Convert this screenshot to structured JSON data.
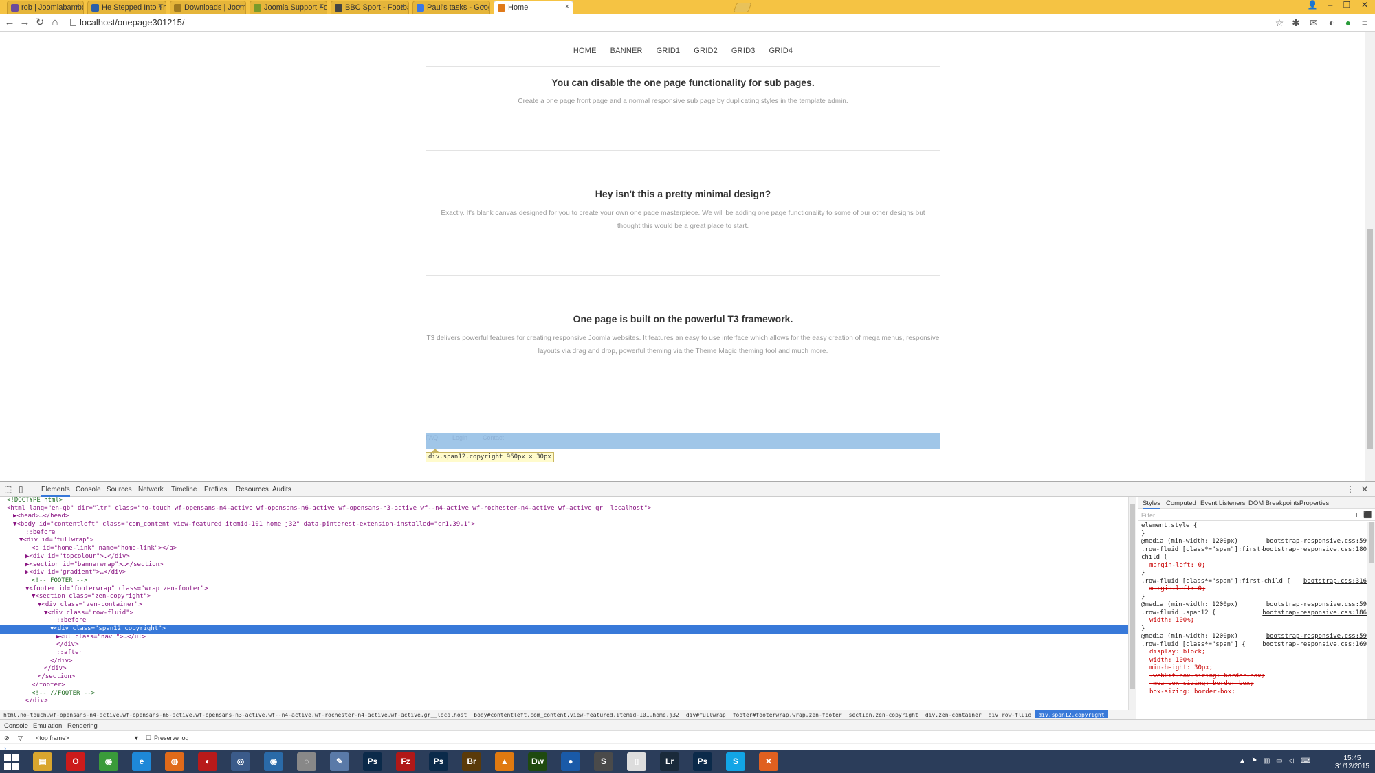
{
  "browser": {
    "tabs": [
      {
        "label": "rob | Joomlabamboo Slack",
        "color": "#6b4c9a"
      },
      {
        "label": "He Stepped Into This Pen",
        "color": "#2c5fa8"
      },
      {
        "label": "Downloads | Joomlabamboo",
        "color": "#a07a20"
      },
      {
        "label": "Joomla Support Forum :: D",
        "color": "#7a9a2a"
      },
      {
        "label": "BBC Sport - Football",
        "color": "#444444"
      },
      {
        "label": "Paul's tasks - Google Docs",
        "color": "#3b78e7"
      },
      {
        "label": "Home",
        "color": "#e07a1a"
      }
    ],
    "address": "localhost/onepage301215/"
  },
  "site": {
    "nav": [
      "HOME",
      "BANNER",
      "GRID1",
      "GRID2",
      "GRID3",
      "GRID4"
    ],
    "sections": [
      {
        "title": "You can disable the one page functionality for sub pages.",
        "text": [
          "Create a one page front page and a normal responsive sub page by duplicating styles in the template admin."
        ]
      },
      {
        "title": "Hey isn't this a pretty minimal design?",
        "text": [
          "Exactly. It's  blank canvas designed for you to create your own one page masterpiece. We will be adding one page functionality to some of our other designs but",
          "thought this would be a great place to start."
        ]
      },
      {
        "title": "One page is built on the powerful T3 framework.",
        "text": [
          "T3 delivers powerful features for creating responsive Joomla websites. It features an easy to use interface which allows for the easy creation of mega menus, responsive",
          "layouts via drag and drop, powerful theming via the Theme Magic theming tool and much more."
        ]
      }
    ],
    "footer_links": [
      "FAQ",
      "Login",
      "Contact"
    ],
    "inspect_tooltip": "div.span12.copyright 960px × 30px"
  },
  "devtools": {
    "tabs": [
      "Elements",
      "Console",
      "Sources",
      "Network",
      "Timeline",
      "Profiles",
      "Resources",
      "Audits"
    ],
    "dom_lines": [
      {
        "indent": 0,
        "text": "<!DOCTYPE html>",
        "kind": "comment"
      },
      {
        "indent": 0,
        "text": "<html lang=\"en-gb\" dir=\"ltr\" class=\"no-touch wf-opensans-n4-active wf-opensans-n6-active wf-opensans-n3-active wf--n4-active wf-rochester-n4-active wf-active gr__localhost\">",
        "kind": "tag"
      },
      {
        "indent": 1,
        "text": "▶<head>…</head>",
        "kind": "tag"
      },
      {
        "indent": 1,
        "text": "▼<body id=\"contentleft\" class=\"com_content view-featured itemid-101 home j32\" data-pinterest-extension-installed=\"cr1.39.1\">",
        "kind": "tag"
      },
      {
        "indent": 3,
        "text": "::before",
        "kind": "pseudo"
      },
      {
        "indent": 2,
        "text": "▼<div id=\"fullwrap\">",
        "kind": "tag"
      },
      {
        "indent": 4,
        "text": "<a id=\"home-link\" name=\"home-link\"></a>",
        "kind": "tag"
      },
      {
        "indent": 3,
        "text": "▶<div id=\"topcolour\">…</div>",
        "kind": "tag"
      },
      {
        "indent": 3,
        "text": "▶<section id=\"bannerwrap\">…</section>",
        "kind": "tag"
      },
      {
        "indent": 3,
        "text": "▶<div id=\"gradient\">…</div>",
        "kind": "tag"
      },
      {
        "indent": 4,
        "text": "<!-- FOOTER -->",
        "kind": "comment"
      },
      {
        "indent": 3,
        "text": "▼<footer id=\"footerwrap\" class=\"wrap zen-footer\">",
        "kind": "tag"
      },
      {
        "indent": 4,
        "text": "▼<section class=\"zen-copyright\">",
        "kind": "tag"
      },
      {
        "indent": 5,
        "text": "▼<div class=\"zen-container\">",
        "kind": "tag"
      },
      {
        "indent": 6,
        "text": "▼<div class=\"row-fluid\">",
        "kind": "tag"
      },
      {
        "indent": 8,
        "text": "::before",
        "kind": "pseudo"
      },
      {
        "indent": 7,
        "text": "▼<div class=\"span12 copyright\">",
        "kind": "selected"
      },
      {
        "indent": 8,
        "text": "▶<ul class=\"nav \">…</ul>",
        "kind": "tag"
      },
      {
        "indent": 8,
        "text": "</div>",
        "kind": "tag"
      },
      {
        "indent": 8,
        "text": "::after",
        "kind": "pseudo"
      },
      {
        "indent": 7,
        "text": "</div>",
        "kind": "tag"
      },
      {
        "indent": 6,
        "text": "</div>",
        "kind": "tag"
      },
      {
        "indent": 5,
        "text": "</section>",
        "kind": "tag"
      },
      {
        "indent": 4,
        "text": "</footer>",
        "kind": "tag"
      },
      {
        "indent": 4,
        "text": "<!-- //FOOTER -->",
        "kind": "comment"
      },
      {
        "indent": 3,
        "text": "</div>",
        "kind": "tag"
      }
    ],
    "breadcrumbs": [
      "html.no-touch.wf-opensans-n4-active.wf-opensans-n6-active.wf-opensans-n3-active.wf--n4-active.wf-rochester-n4-active.wf-active.gr__localhost",
      "body#contentleft.com_content.view-featured.itemid-101.home.j32",
      "div#fullwrap",
      "footer#footerwrap.wrap.zen-footer",
      "section.zen-copyright",
      "div.zen-container",
      "div.row-fluid",
      "div.span12.copyright"
    ],
    "sidebar_tabs": [
      "Styles",
      "Computed",
      "Event Listeners",
      "DOM Breakpoints",
      "Properties"
    ],
    "filter_placeholder": "Filter",
    "style_lines": [
      {
        "text": "element.style {",
        "src": "",
        "kind": "sel"
      },
      {
        "text": "}",
        "src": "",
        "kind": "sel"
      },
      {
        "text": "@media (min-width: 1200px)",
        "src": "bootstrap-responsive.css:59",
        "kind": "sel"
      },
      {
        "text": ".row-fluid [class*=\"span\"]:first-",
        "src": "bootstrap-responsive.css:180",
        "kind": "sel"
      },
      {
        "text": "child {",
        "src": "",
        "kind": "sel"
      },
      {
        "text": "margin-left: 0;",
        "src": "",
        "kind": "struck"
      },
      {
        "text": "}",
        "src": "",
        "kind": "sel"
      },
      {
        "text": ".row-fluid [class*=\"span\"]:first-child {",
        "src": "bootstrap.css:316",
        "kind": "sel"
      },
      {
        "text": "margin-left: 0;",
        "src": "",
        "kind": "struck"
      },
      {
        "text": "}",
        "src": "",
        "kind": "sel"
      },
      {
        "text": "@media (min-width: 1200px)",
        "src": "bootstrap-responsive.css:59",
        "kind": "sel"
      },
      {
        "text": ".row-fluid .span12 {",
        "src": "bootstrap-responsive.css:186",
        "kind": "sel"
      },
      {
        "text": "width: 100%;",
        "src": "",
        "kind": "prop"
      },
      {
        "text": "}",
        "src": "",
        "kind": "sel"
      },
      {
        "text": "@media (min-width: 1200px)",
        "src": "bootstrap-responsive.css:59",
        "kind": "sel"
      },
      {
        "text": ".row-fluid [class*=\"span\"] {",
        "src": "bootstrap-responsive.css:169",
        "kind": "sel"
      },
      {
        "text": "display: block;",
        "src": "",
        "kind": "prop"
      },
      {
        "text": "width: 100%;",
        "src": "",
        "kind": "struck"
      },
      {
        "text": "min-height: 30px;",
        "src": "",
        "kind": "prop"
      },
      {
        "text": "-webkit-box-sizing: border-box;",
        "src": "",
        "kind": "struck"
      },
      {
        "text": "-moz-box-sizing: border-box;",
        "src": "",
        "kind": "struck"
      },
      {
        "text": "box-sizing: border-box;",
        "src": "",
        "kind": "prop"
      }
    ],
    "drawer_tabs": [
      "Console",
      "Emulation",
      "Rendering"
    ],
    "frame_select": "<top frame>",
    "preserve_log": "Preserve log"
  },
  "taskbar": {
    "apps": [
      {
        "icon": "file-explorer-icon",
        "glyph": "▤",
        "color": "#d9a62e"
      },
      {
        "icon": "opera-icon",
        "glyph": "O",
        "color": "#cc1b1b"
      },
      {
        "icon": "chrome-icon",
        "glyph": "◉",
        "color": "#3a9b3a"
      },
      {
        "icon": "ie-icon",
        "glyph": "e",
        "color": "#1e88d8"
      },
      {
        "icon": "firefox-icon",
        "glyph": "◍",
        "color": "#e06a1a"
      },
      {
        "icon": "app-red-icon",
        "glyph": "◐",
        "color": "#b81a1a"
      },
      {
        "icon": "app-globe-icon",
        "glyph": "◎",
        "color": "#3b5b8a"
      },
      {
        "icon": "app-search-icon",
        "glyph": "◉",
        "color": "#2a6aa8"
      },
      {
        "icon": "app-disc-icon",
        "glyph": "◌",
        "color": "#888888"
      },
      {
        "icon": "notepad-icon",
        "glyph": "✎",
        "color": "#5a7aa8"
      },
      {
        "icon": "photoshop-icon",
        "glyph": "Ps",
        "color": "#0b2a4a"
      },
      {
        "icon": "filezilla-icon",
        "glyph": "Fz",
        "color": "#b01818"
      },
      {
        "icon": "photoshop-icon-2",
        "glyph": "Ps",
        "color": "#0b2a4a"
      },
      {
        "icon": "bridge-icon",
        "glyph": "Br",
        "color": "#5a3a0a"
      },
      {
        "icon": "vlc-icon",
        "glyph": "▲",
        "color": "#e07a10"
      },
      {
        "icon": "dreamweaver-icon",
        "glyph": "Dw",
        "color": "#1f4a10"
      },
      {
        "icon": "app-blue-icon",
        "glyph": "●",
        "color": "#1a5aa8"
      },
      {
        "icon": "sublime-icon",
        "glyph": "S",
        "color": "#4a4a4a"
      },
      {
        "icon": "document-icon",
        "glyph": "▯",
        "color": "#dddddd"
      },
      {
        "icon": "lightroom-icon",
        "glyph": "Lr",
        "color": "#1a2a3a"
      },
      {
        "icon": "photoshop-icon-3",
        "glyph": "Ps",
        "color": "#0b2a4a"
      },
      {
        "icon": "skype-icon",
        "glyph": "S",
        "color": "#12a5e6"
      },
      {
        "icon": "xampp-icon",
        "glyph": "✕",
        "color": "#e06020"
      }
    ],
    "time": "15:45",
    "date": "31/12/2015"
  }
}
